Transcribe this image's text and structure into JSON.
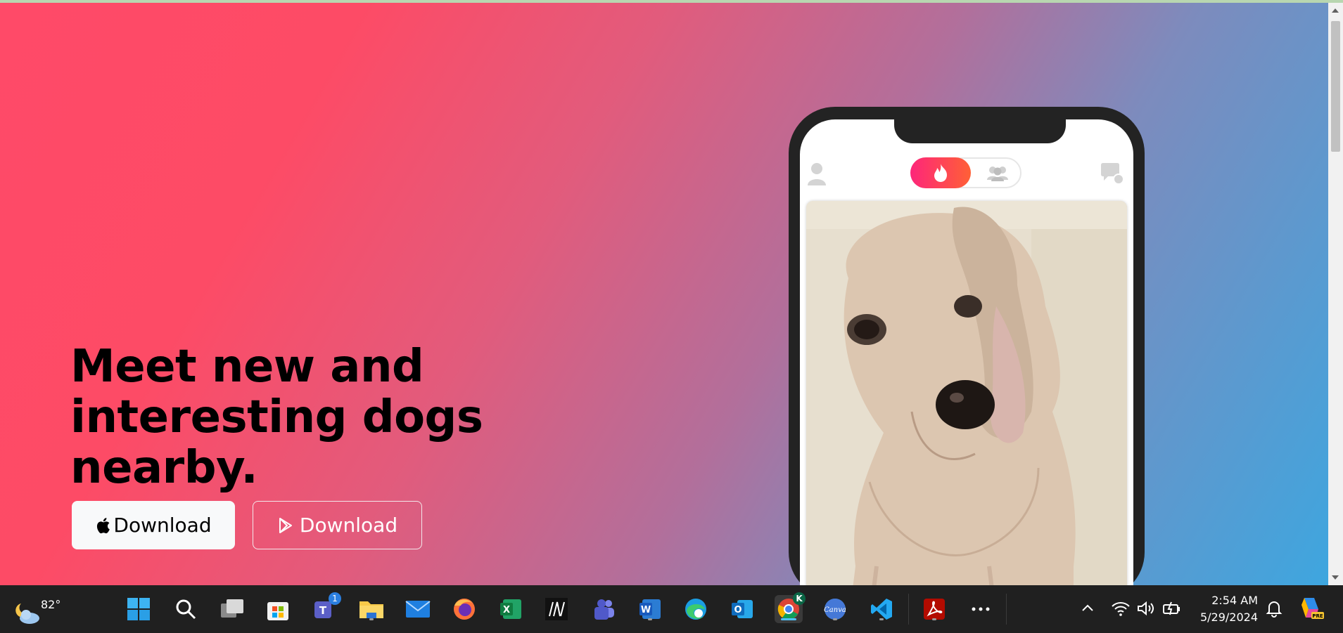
{
  "hero": {
    "headline": "Meet new and interesting dogs nearby.",
    "apple_button_label": "Download",
    "play_button_label": "Download"
  },
  "colors": {
    "gradient_start": "#fd4b66",
    "gradient_end": "#3ea6df",
    "brand_gradient_left": "#fd267a",
    "brand_gradient_right": "#ff6036"
  },
  "phone": {
    "left_icon": "profile-icon",
    "toggle_active_icon": "flame-icon",
    "toggle_inactive_icon": "group-icon",
    "right_icon": "chat-icon",
    "card_image": "dog-photo"
  },
  "taskbar": {
    "weather_temp": "82°",
    "apps": [
      "start",
      "search",
      "task-view",
      "microsoft-store",
      "teams",
      "file-explorer",
      "mail",
      "firefox",
      "excel",
      "m-app",
      "teams-work",
      "word",
      "edge",
      "outlook",
      "chrome",
      "canva",
      "vscode",
      "acrobat",
      "more"
    ],
    "teams_badge": "1",
    "chrome_profile": "K",
    "time": "2:54 AM",
    "date": "5/29/2024"
  }
}
